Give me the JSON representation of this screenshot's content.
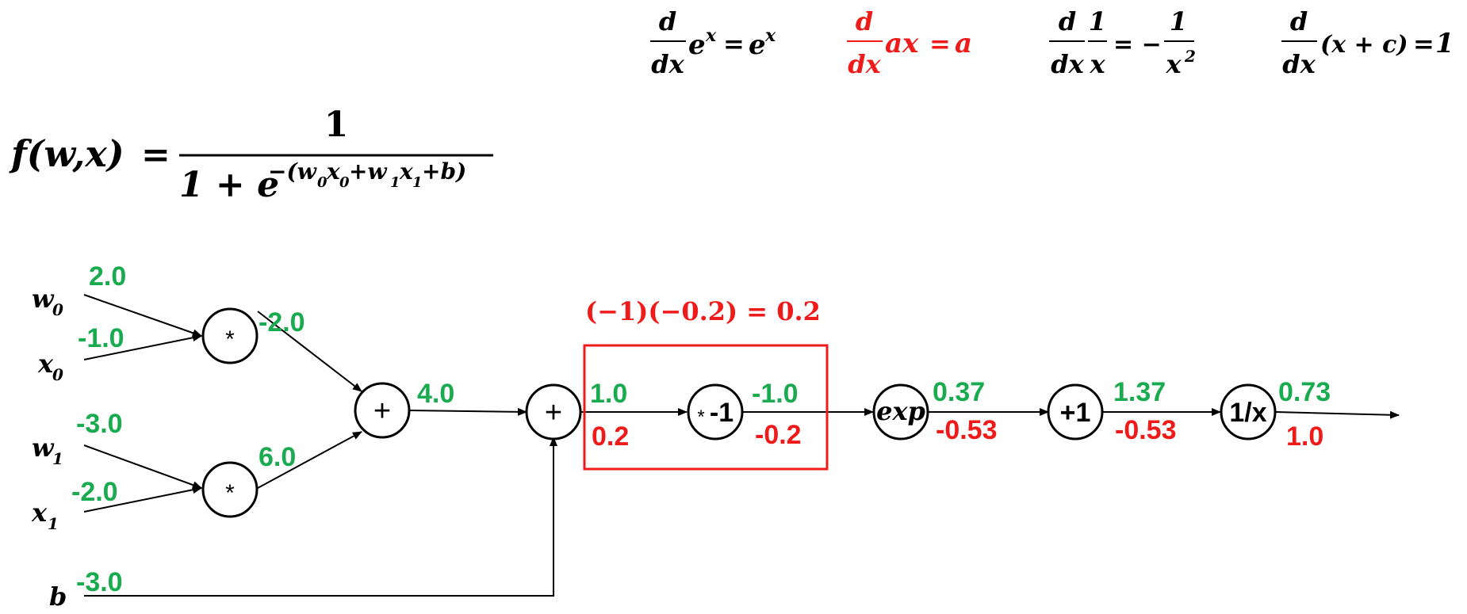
{
  "derivatives": {
    "exp": {
      "num": "d",
      "den": "dx",
      "body": "e",
      "sup": "x",
      "eq": "=",
      "rhs": "e",
      "rhs_sup": "x"
    },
    "linear": {
      "num": "d",
      "den": "dx",
      "body": "ax",
      "eq": "=",
      "rhs": "a"
    },
    "recip": {
      "num": "d",
      "den": "dx",
      "one": "1",
      "x": "x",
      "eq": "= −",
      "rhs_num": "1",
      "rhs_den": "x",
      "rhs_sup": "2"
    },
    "const": {
      "num": "d",
      "den": "dx",
      "body": "(x + c)",
      "eq": "=",
      "rhs": "1"
    }
  },
  "formula": {
    "lhs": "f(w,x)",
    "eq": "=",
    "num": "1",
    "den_base": "1 + e",
    "den_exp": "−(w",
    "e_w0_sub": "0",
    "e_x0": "x",
    "e_x0_sub": "0",
    "e_plus1": "+w",
    "e_w1_sub": "1",
    "e_x1": "x",
    "e_x1_sub": "1",
    "e_tail": "+b)"
  },
  "inputs": {
    "w0": {
      "name": "w",
      "sub": "0",
      "value": "2.0"
    },
    "x0": {
      "name": "x",
      "sub": "0",
      "value": "-1.0"
    },
    "w1": {
      "name": "w",
      "sub": "1",
      "value": "-3.0"
    },
    "x1": {
      "name": "x",
      "sub": "1",
      "value": "-2.0"
    },
    "b": {
      "name": "b",
      "value": "-3.0"
    }
  },
  "nodes": {
    "mul0": "*",
    "mul1": "*",
    "add0": "+",
    "add1": "+",
    "neg_star": "*",
    "neg_val": "-1",
    "exp": "exp",
    "plus1": "+1",
    "recip": "1/x"
  },
  "forward": {
    "mul0_out": "-2.0",
    "mul1_out": "6.0",
    "add0_out": "4.0",
    "add1_out": "1.0",
    "neg_out": "-1.0",
    "exp_out": "0.37",
    "plus1_out": "1.37",
    "recip_out": "0.73"
  },
  "backward": {
    "add1_out": "0.2",
    "neg_out": "-0.2",
    "exp_out": "-0.53",
    "plus1_out": "-0.53",
    "recip_out": "1.0"
  },
  "highlight": {
    "annotation": "(−1)(−0.2) = 0.2",
    "color": "#ef1b1b"
  },
  "colors": {
    "forward": "#1aab50",
    "backward": "#ef1b1b",
    "ink": "#000000"
  }
}
